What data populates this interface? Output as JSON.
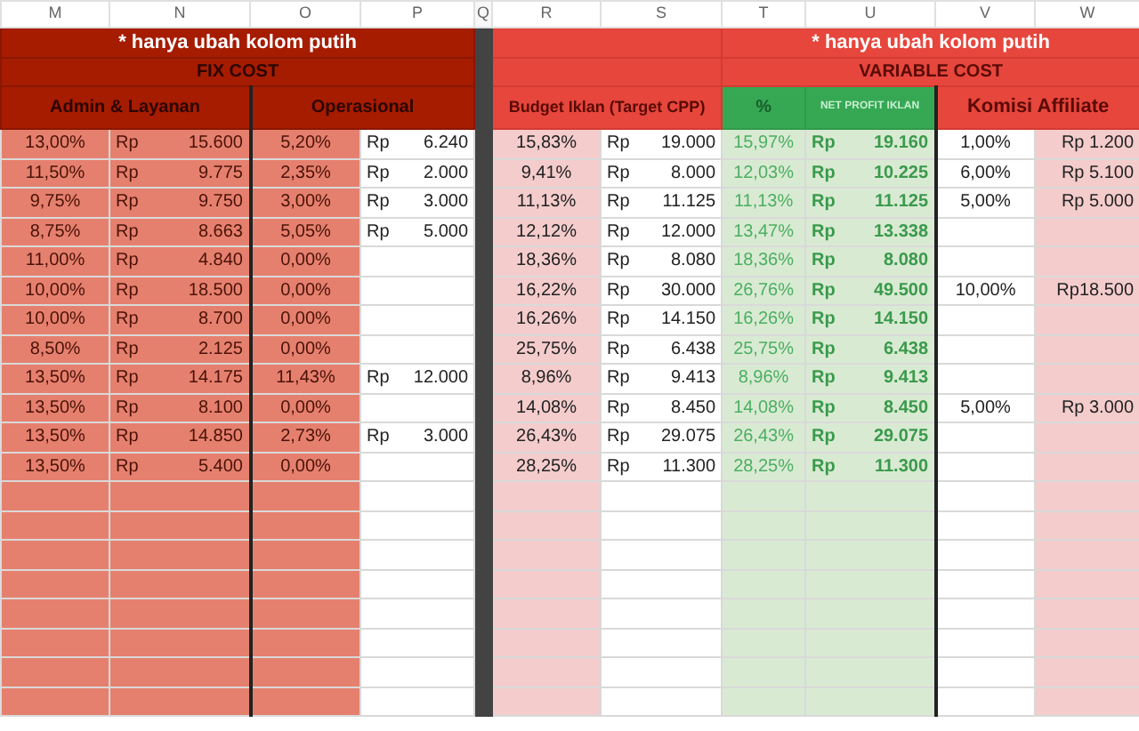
{
  "column_letters": [
    "M",
    "N",
    "O",
    "P",
    "Q",
    "R",
    "S",
    "T",
    "U",
    "V",
    "W"
  ],
  "fix_cost": {
    "note": "* hanya ubah kolom putih",
    "title": "FIX COST",
    "headers": [
      "Admin & Layanan",
      "Operasional"
    ]
  },
  "variable_cost": {
    "note": "* hanya ubah kolom putih",
    "title": "VARIABLE COST",
    "headers": [
      "Budget Iklan (Target CPP)",
      "%",
      "NET PROFIT IKLAN",
      "Komisi Affiliate"
    ]
  },
  "rows": [
    {
      "m": "13,00%",
      "n": [
        "Rp",
        "15.600"
      ],
      "o": "5,20%",
      "p": [
        "Rp",
        "6.240"
      ],
      "r": "15,83%",
      "s": [
        "Rp",
        "19.000"
      ],
      "t": "15,97%",
      "u": [
        "Rp",
        "19.160"
      ],
      "v": "1,00%",
      "w": "Rp 1.200"
    },
    {
      "m": "11,50%",
      "n": [
        "Rp",
        "9.775"
      ],
      "o": "2,35%",
      "p": [
        "Rp",
        "2.000"
      ],
      "r": "9,41%",
      "s": [
        "Rp",
        "8.000"
      ],
      "t": "12,03%",
      "u": [
        "Rp",
        "10.225"
      ],
      "v": "6,00%",
      "w": "Rp 5.100"
    },
    {
      "m": "9,75%",
      "n": [
        "Rp",
        "9.750"
      ],
      "o": "3,00%",
      "p": [
        "Rp",
        "3.000"
      ],
      "r": "11,13%",
      "s": [
        "Rp",
        "11.125"
      ],
      "t": "11,13%",
      "u": [
        "Rp",
        "11.125"
      ],
      "v": "5,00%",
      "w": "Rp 5.000"
    },
    {
      "m": "8,75%",
      "n": [
        "Rp",
        "8.663"
      ],
      "o": "5,05%",
      "p": [
        "Rp",
        "5.000"
      ],
      "r": "12,12%",
      "s": [
        "Rp",
        "12.000"
      ],
      "t": "13,47%",
      "u": [
        "Rp",
        "13.338"
      ]
    },
    {
      "m": "11,00%",
      "n": [
        "Rp",
        "4.840"
      ],
      "o": "0,00%",
      "r": "18,36%",
      "s": [
        "Rp",
        "8.080"
      ],
      "t": "18,36%",
      "u": [
        "Rp",
        "8.080"
      ]
    },
    {
      "m": "10,00%",
      "n": [
        "Rp",
        "18.500"
      ],
      "o": "0,00%",
      "r": "16,22%",
      "s": [
        "Rp",
        "30.000"
      ],
      "t": "26,76%",
      "u": [
        "Rp",
        "49.500"
      ],
      "v": "10,00%",
      "w": "Rp18.500"
    },
    {
      "m": "10,00%",
      "n": [
        "Rp",
        "8.700"
      ],
      "o": "0,00%",
      "r": "16,26%",
      "s": [
        "Rp",
        "14.150"
      ],
      "t": "16,26%",
      "u": [
        "Rp",
        "14.150"
      ]
    },
    {
      "m": "8,50%",
      "n": [
        "Rp",
        "2.125"
      ],
      "o": "0,00%",
      "r": "25,75%",
      "s": [
        "Rp",
        "6.438"
      ],
      "t": "25,75%",
      "u": [
        "Rp",
        "6.438"
      ]
    },
    {
      "m": "13,50%",
      "n": [
        "Rp",
        "14.175"
      ],
      "o": "11,43%",
      "p": [
        "Rp",
        "12.000"
      ],
      "r": "8,96%",
      "s": [
        "Rp",
        "9.413"
      ],
      "t": "8,96%",
      "u": [
        "Rp",
        "9.413"
      ]
    },
    {
      "m": "13,50%",
      "n": [
        "Rp",
        "8.100"
      ],
      "o": "0,00%",
      "r": "14,08%",
      "s": [
        "Rp",
        "8.450"
      ],
      "t": "14,08%",
      "u": [
        "Rp",
        "8.450"
      ],
      "v": "5,00%",
      "w": "Rp 3.000"
    },
    {
      "m": "13,50%",
      "n": [
        "Rp",
        "14.850"
      ],
      "o": "2,73%",
      "p": [
        "Rp",
        "3.000"
      ],
      "r": "26,43%",
      "s": [
        "Rp",
        "29.075"
      ],
      "t": "26,43%",
      "u": [
        "Rp",
        "29.075"
      ]
    },
    {
      "m": "13,50%",
      "n": [
        "Rp",
        "5.400"
      ],
      "o": "0,00%",
      "r": "28,25%",
      "s": [
        "Rp",
        "11.300"
      ],
      "t": "28,25%",
      "u": [
        "Rp",
        "11.300"
      ]
    }
  ]
}
